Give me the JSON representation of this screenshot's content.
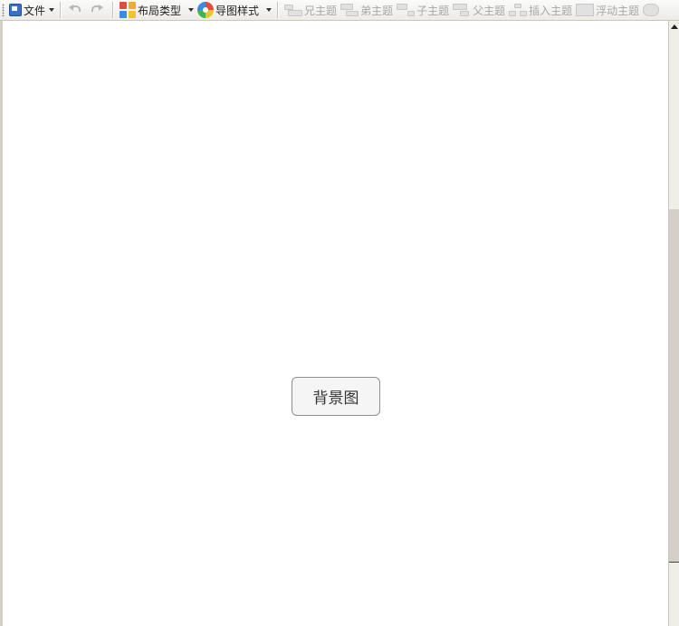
{
  "toolbar": {
    "file_label": "文件",
    "layout_label": "布局类型",
    "style_label": "导图样式",
    "sibling_label": "兄主题",
    "younger_label": "弟主题",
    "child_label": "子主题",
    "parent_label": "父主题",
    "insert_label": "插入主题",
    "float_label": "浮动主题",
    "icons": [
      "file-icon",
      "undo-icon",
      "redo-icon",
      "layout-icon",
      "style-icon",
      "sibling-topic-icon",
      "younger-topic-icon",
      "child-topic-icon",
      "parent-topic-icon",
      "insert-topic-icon",
      "float-topic-icon"
    ]
  },
  "canvas": {
    "central_topic": "背景图"
  },
  "colors": {
    "layout_squares": [
      "#e24c3d",
      "#f2a93b",
      "#3d8be0",
      "#f2c230"
    ],
    "disabled_text": "#a8a8a8",
    "canvas_bg": "#ffffff",
    "toolbar_bg": "#f4f3ef"
  }
}
